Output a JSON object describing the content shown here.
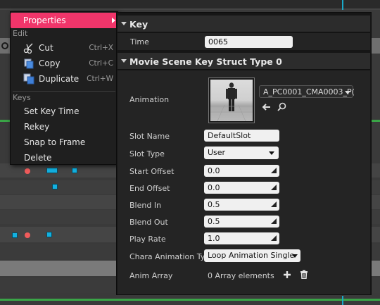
{
  "context_menu": {
    "properties_label": "Properties",
    "edit_header": "Edit",
    "cut_label": "Cut",
    "cut_shortcut": "Ctrl+X",
    "copy_label": "Copy",
    "copy_shortcut": "Ctrl+C",
    "duplicate_label": "Duplicate",
    "duplicate_shortcut": "Ctrl+W",
    "keys_header": "Keys",
    "set_key_time_label": "Set Key Time",
    "rekey_label": "Rekey",
    "snap_to_frame_label": "Snap to Frame",
    "delete_label": "Delete"
  },
  "details": {
    "key_section": "Key",
    "time_label": "Time",
    "time_value": "0065",
    "struct_section": "Movie Scene Key Struct Type 0",
    "animation_label": "Animation",
    "animation_asset": "A_PC0001_CMA0003_P(",
    "slot_name_label": "Slot Name",
    "slot_name_value": "DefaultSlot",
    "slot_type_label": "Slot Type",
    "slot_type_value": "User",
    "start_offset_label": "Start Offset",
    "start_offset_value": "0.0",
    "end_offset_label": "End Offset",
    "end_offset_value": "0.0",
    "blend_in_label": "Blend In",
    "blend_in_value": "0.5",
    "blend_out_label": "Blend Out",
    "blend_out_value": "0.5",
    "play_rate_label": "Play Rate",
    "play_rate_value": "1.0",
    "chara_anim_type_label": "Chara Animation Typ",
    "chara_anim_type_value": "Loop Animation Single",
    "anim_array_label": "Anim Array",
    "anim_array_value": "0 Array elements"
  },
  "colors": {
    "menu_highlight": "#f0356a",
    "key_marker_red": "#f05b5b",
    "key_marker_cyan": "#13b0e0",
    "timeline_green": "#3aa547"
  }
}
